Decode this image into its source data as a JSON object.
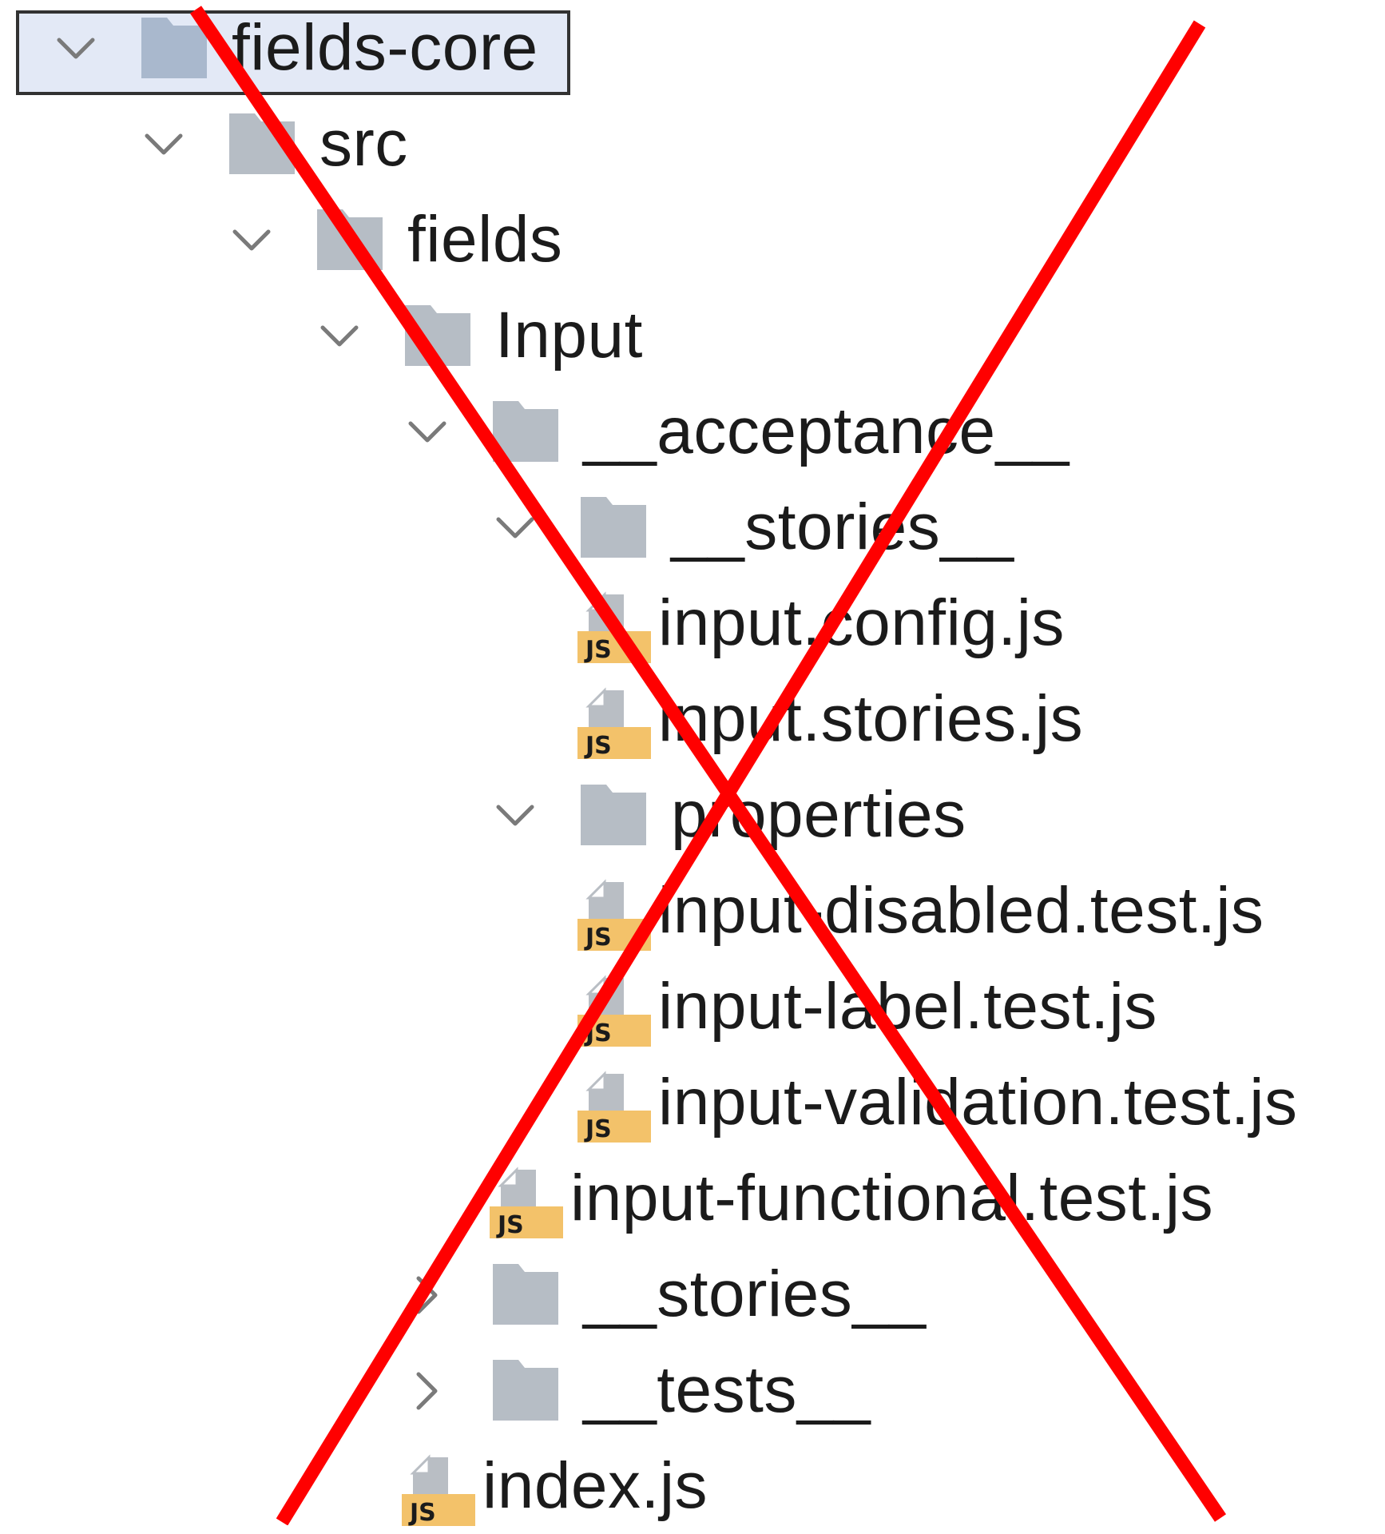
{
  "tree": [
    {
      "label": "fields-core",
      "kind": "folder",
      "depth": 0,
      "chevron": "expanded",
      "selected": true,
      "folder_color": "#a9b8cd"
    },
    {
      "label": "src",
      "kind": "folder",
      "depth": 1,
      "chevron": "expanded",
      "folder_color": "#b6bdc5"
    },
    {
      "label": "fields",
      "kind": "folder",
      "depth": 2,
      "chevron": "expanded",
      "folder_color": "#b6bdc5"
    },
    {
      "label": "Input",
      "kind": "folder",
      "depth": 3,
      "chevron": "expanded",
      "folder_color": "#b6bdc5"
    },
    {
      "label": "__acceptance__",
      "kind": "folder",
      "depth": 4,
      "chevron": "expanded",
      "folder_color": "#b6bdc5"
    },
    {
      "label": "__stories__",
      "kind": "folder",
      "depth": 5,
      "chevron": "expanded",
      "folder_color": "#b6bdc5"
    },
    {
      "label": "input.config.js",
      "kind": "js-file",
      "depth": 6
    },
    {
      "label": "input.stories.js",
      "kind": "js-file",
      "depth": 6
    },
    {
      "label": "properties",
      "kind": "folder",
      "depth": 5,
      "chevron": "expanded",
      "folder_color": "#b6bdc5"
    },
    {
      "label": "input-disabled.test.js",
      "kind": "js-file",
      "depth": 6
    },
    {
      "label": "input-label.test.js",
      "kind": "js-file",
      "depth": 6
    },
    {
      "label": "input-validation.test.js",
      "kind": "js-file",
      "depth": 6
    },
    {
      "label": "input-functional.test.js",
      "kind": "js-file",
      "depth": 5
    },
    {
      "label": "__stories__",
      "kind": "folder",
      "depth": 4,
      "chevron": "collapsed",
      "folder_color": "#b6bdc5"
    },
    {
      "label": "__tests__",
      "kind": "folder",
      "depth": 4,
      "chevron": "collapsed",
      "folder_color": "#b6bdc5"
    },
    {
      "label": "index.js",
      "kind": "js-file",
      "depth": 4
    }
  ],
  "icons": {
    "chevron_expanded": "chevron-down-icon",
    "chevron_collapsed": "chevron-right-icon",
    "folder": "folder-icon",
    "js_file": "js-file-icon",
    "js_badge_text": "JS"
  },
  "colors": {
    "cross_out": "#ff0000",
    "chevron": "#7a7a7a",
    "js_badge": "#f3c26a",
    "js_page": "#b9bec4",
    "selection_bg": "#e3e9f6",
    "selection_border": "#323232"
  }
}
